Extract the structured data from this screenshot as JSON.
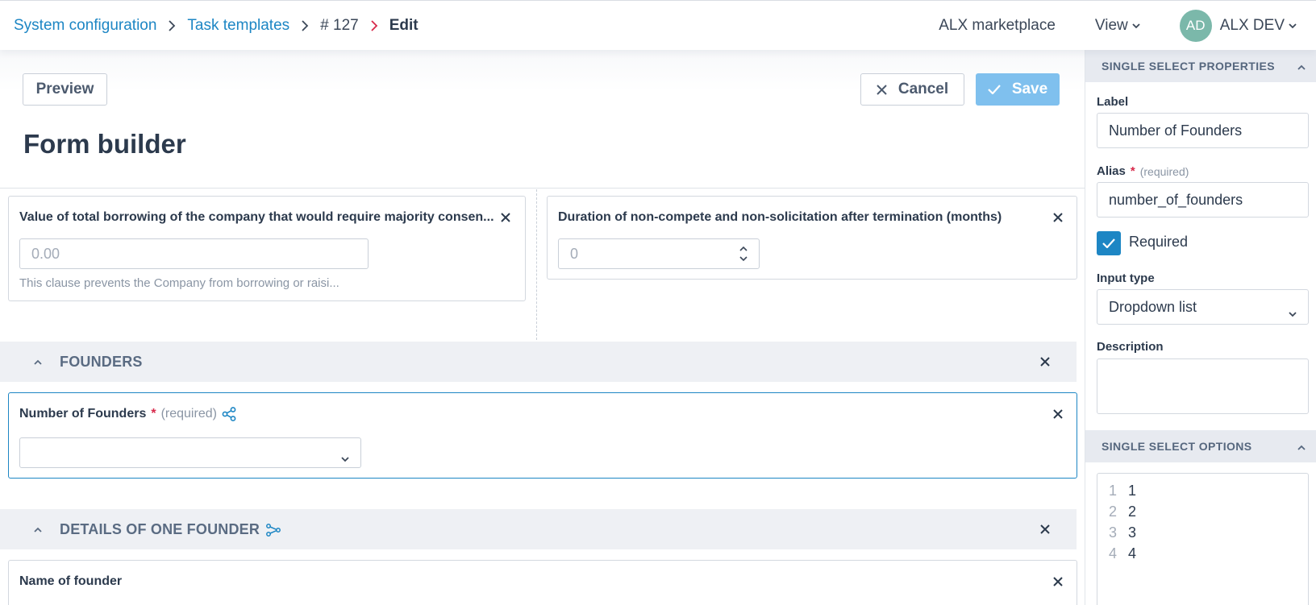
{
  "breadcrumb": {
    "items": [
      "System configuration",
      "Task templates",
      "# 127",
      "Edit"
    ]
  },
  "header": {
    "marketplace": "ALX marketplace",
    "view": "View",
    "user_initials": "AD",
    "user_name": "ALX DEV"
  },
  "toolbar": {
    "preview": "Preview",
    "cancel": "Cancel",
    "save": "Save"
  },
  "page_title": "Form builder",
  "fields": {
    "borrowing": {
      "label": "Value of total borrowing of the company that would require majority consen...",
      "placeholder": "0.00",
      "hint": "This clause prevents the Company from borrowing or raisi..."
    },
    "noncompete": {
      "label": "Duration of non-compete and non-solicitation after termination (months)",
      "placeholder": "0"
    },
    "number_of_founders": {
      "label": "Number of Founders",
      "required_star": "*",
      "required_text": "(required)",
      "value": ""
    },
    "name_of_founder": {
      "label": "Name of founder"
    }
  },
  "sections": {
    "founders": "FOUNDERS",
    "details": "DETAILS OF ONE FOUNDER"
  },
  "panel": {
    "properties_title": "SINGLE SELECT PROPERTIES",
    "label_label": "Label",
    "label_value": "Number of Founders",
    "alias_label": "Alias",
    "alias_star": "*",
    "alias_required": "(required)",
    "alias_value": "number_of_founders",
    "required_label": "Required",
    "required_checked": true,
    "input_type_label": "Input type",
    "input_type_value": "Dropdown list",
    "description_label": "Description",
    "description_value": "",
    "options_title": "SINGLE SELECT OPTIONS",
    "options": [
      {
        "num": "1",
        "val": "1"
      },
      {
        "num": "2",
        "val": "2"
      },
      {
        "num": "3",
        "val": "3"
      },
      {
        "num": "4",
        "val": "4"
      }
    ]
  },
  "colors": {
    "link": "#1d86c4",
    "save_disabled": "#7fc0ee",
    "required": "#d7294a",
    "avatar": "#7bb8aa"
  }
}
